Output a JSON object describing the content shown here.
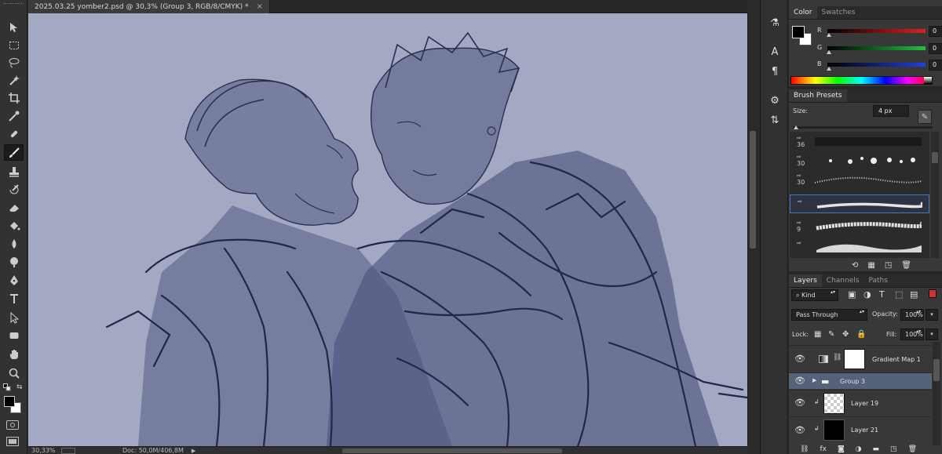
{
  "document": {
    "tab_title": "2025.03.25 yomber2.psd @ 30,3% (Group 3, RGB/8/CMYK) *",
    "close_glyph": "×"
  },
  "status": {
    "zoom": "30,33%",
    "doc_info": "Doc: 50,0M/406,8M"
  },
  "toolbar": {
    "tools": [
      "move-tool",
      "marquee-tool",
      "lasso-tool",
      "magic-wand-tool",
      "crop-tool",
      "eyedropper-tool",
      "healing-brush-tool",
      "brush-tool",
      "clone-stamp-tool",
      "history-brush-tool",
      "eraser-tool",
      "paint-bucket-tool",
      "blur-tool",
      "dodge-tool",
      "pen-tool",
      "type-tool",
      "path-selection-tool",
      "shape-tool",
      "hand-tool",
      "zoom-tool"
    ],
    "active_tool": "brush-tool",
    "foreground_color": "#000000",
    "background_color": "#ffffff"
  },
  "color_panel": {
    "tabs": [
      "Color",
      "Swatches"
    ],
    "active_tab": "Color",
    "channels": [
      {
        "label": "R",
        "value": "0",
        "track_color": "#c0262a"
      },
      {
        "label": "G",
        "value": "0",
        "track_color": "#23a238"
      },
      {
        "label": "B",
        "value": "0",
        "track_color": "#2a3cc4"
      }
    ]
  },
  "brush_presets": {
    "tab": "Brush Presets",
    "size_label": "Size:",
    "size_value": "4 px",
    "brushes": [
      {
        "num": "36",
        "kind": "hard",
        "selected": false
      },
      {
        "num": "30",
        "kind": "bokeh",
        "selected": false
      },
      {
        "num": "30",
        "kind": "sparkle",
        "selected": false
      },
      {
        "num": "",
        "kind": "chalk",
        "selected": true
      },
      {
        "num": "9",
        "kind": "dry",
        "selected": false
      },
      {
        "num": "",
        "kind": "texture",
        "selected": false
      }
    ]
  },
  "layers_panel": {
    "tabs": [
      "Layers",
      "Channels",
      "Paths"
    ],
    "active_tab": "Layers",
    "filter_kind": "Kind",
    "blend_mode": "Pass Through",
    "opacity_label": "Opacity:",
    "opacity": "100%",
    "lock_label": "Lock:",
    "fill_label": "Fill:",
    "fill": "100%",
    "layers": [
      {
        "name": "Gradient Map 1",
        "type": "adjustment",
        "selected": false
      },
      {
        "name": "Group 3",
        "type": "group",
        "selected": true
      },
      {
        "name": "Layer 19",
        "type": "transparent",
        "selected": false
      },
      {
        "name": "Layer 21",
        "type": "black",
        "selected": false
      }
    ]
  },
  "canvas": {
    "background_color": "#a3a9c2",
    "line_color": "#2b2f52",
    "fill_color": "#535a82"
  }
}
